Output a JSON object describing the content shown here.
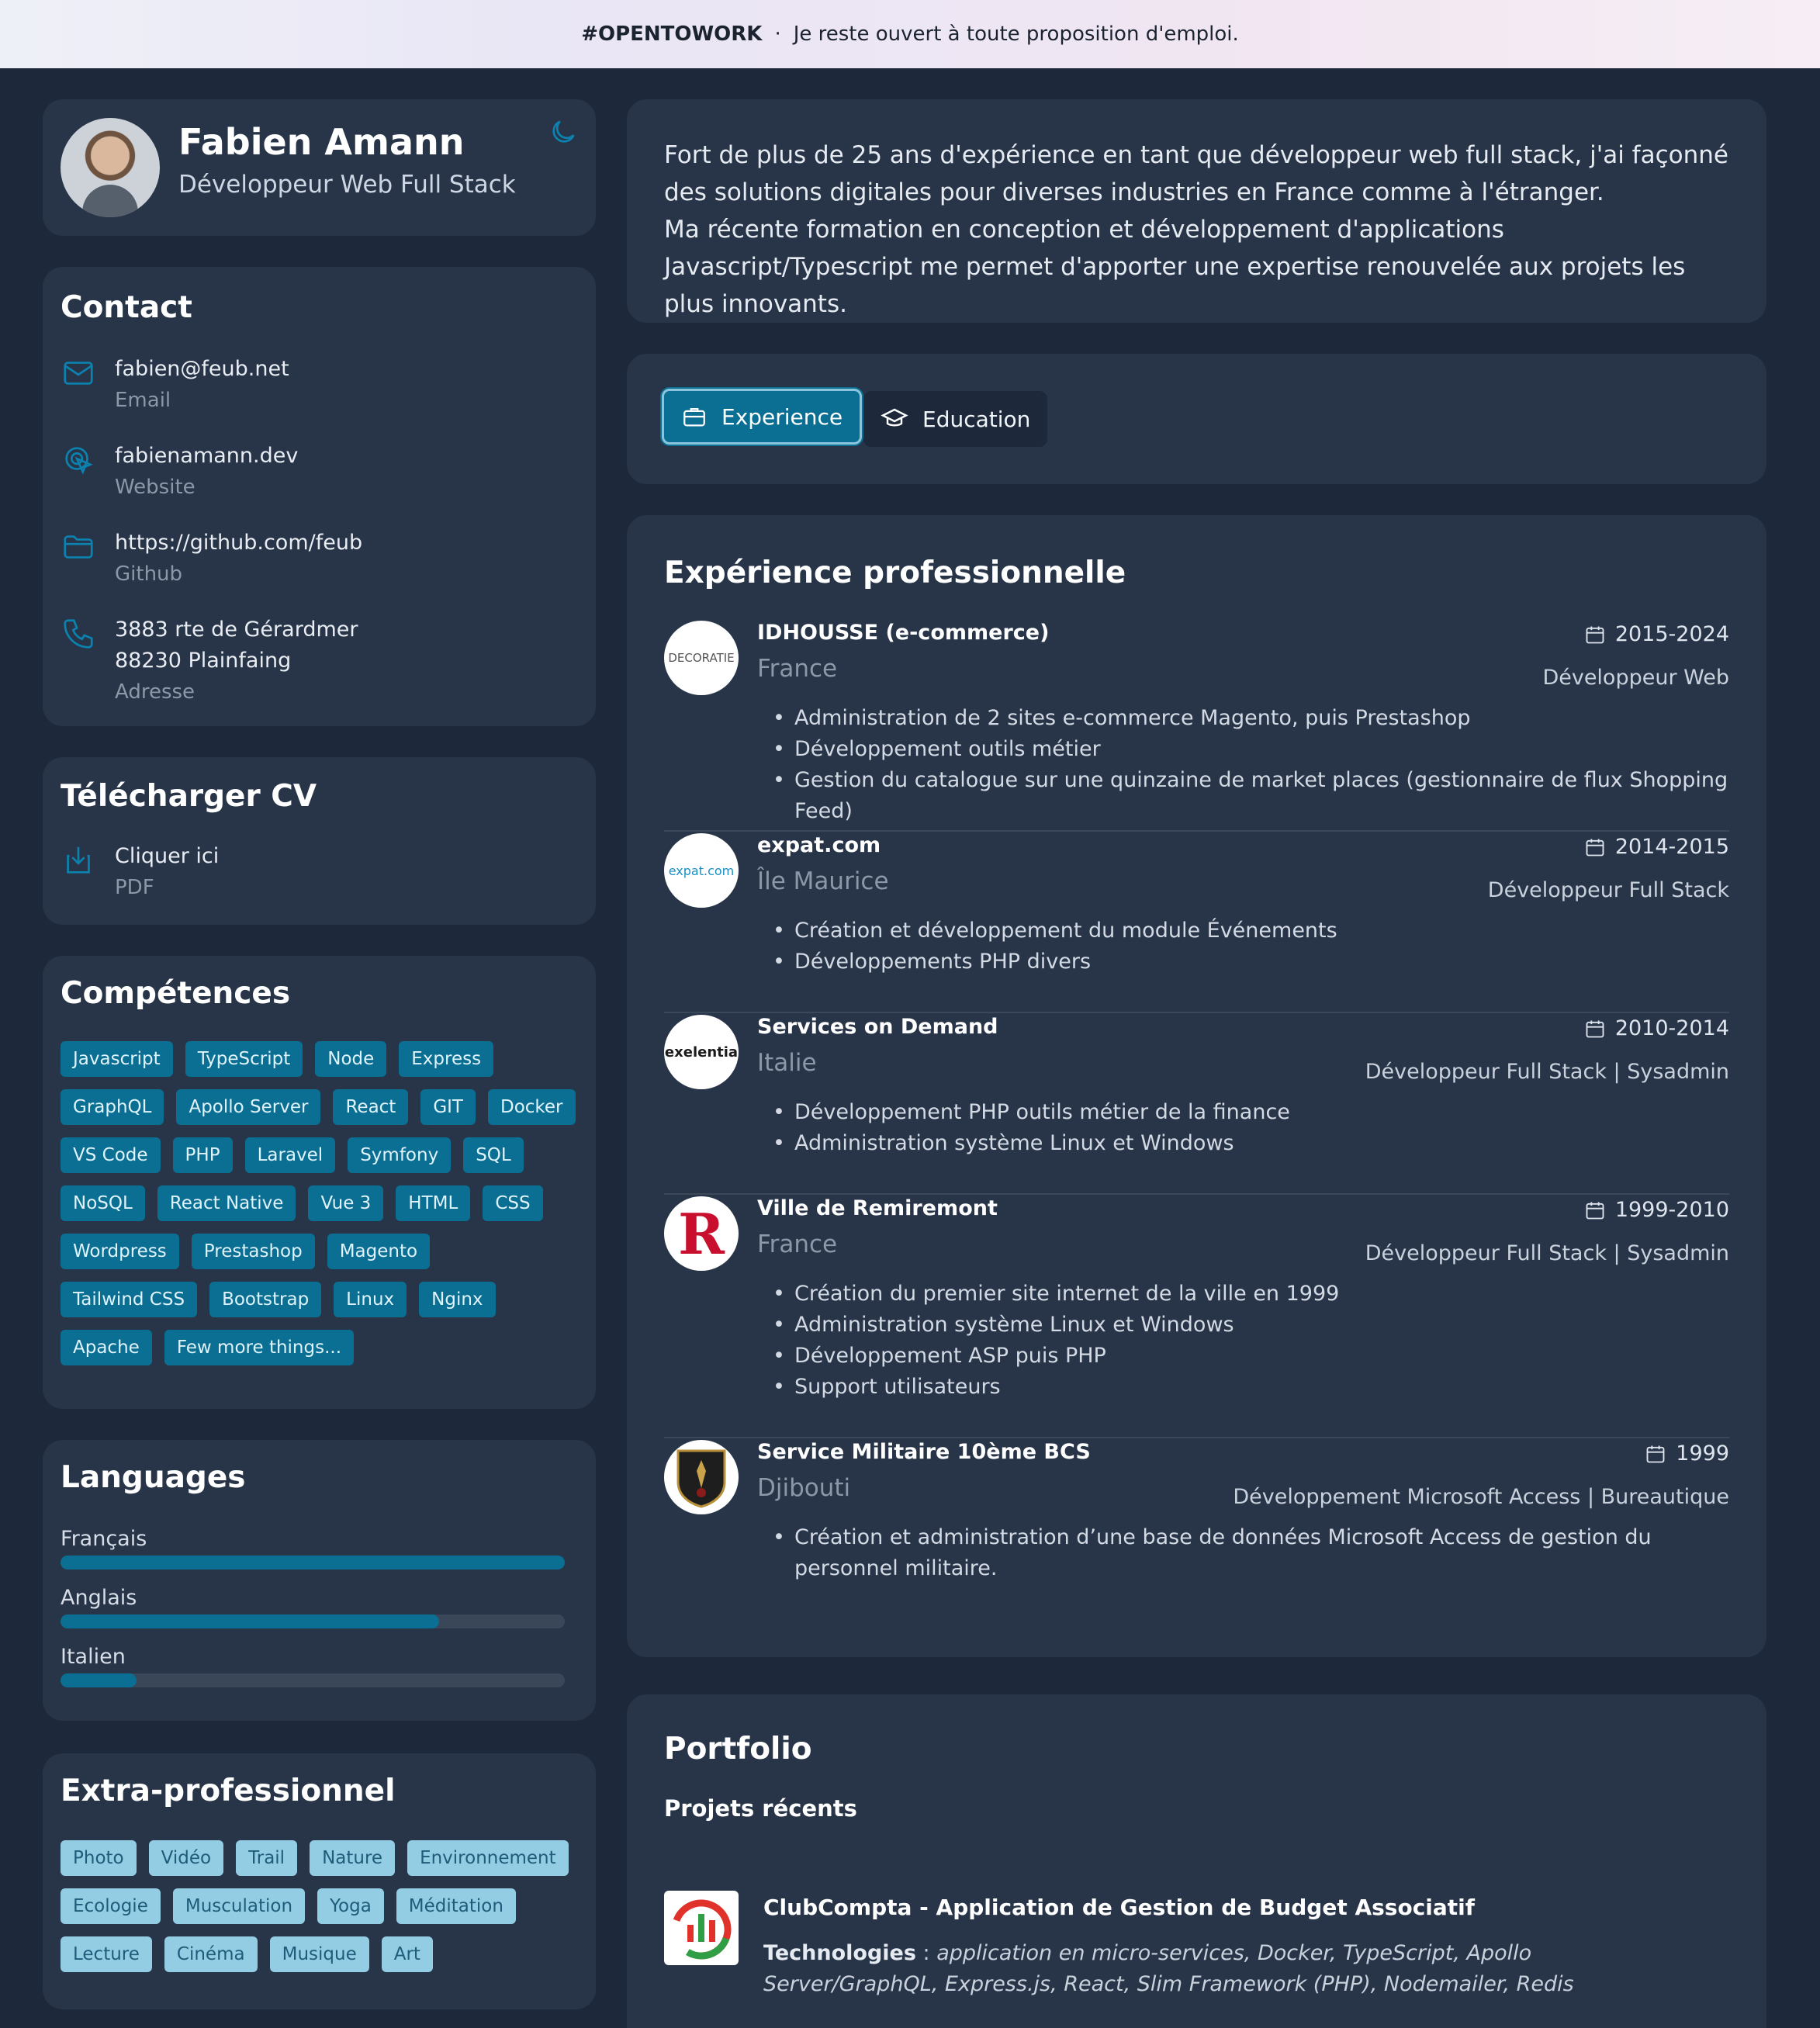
{
  "banner": {
    "tag": "#OPENTOWORK",
    "sep": "·",
    "text": "Je reste ouvert à toute proposition d'emploi."
  },
  "profile": {
    "name": "Fabien Amann",
    "title": "Développeur Web Full Stack",
    "theme_icon": "moon-icon"
  },
  "contact": {
    "title": "Contact",
    "items": [
      {
        "icon": "mail-icon",
        "value": "fabien@feub.net",
        "label": "Email"
      },
      {
        "icon": "pointer-icon",
        "value": "fabienamann.dev",
        "label": "Website"
      },
      {
        "icon": "folder-icon",
        "value": "https://github.com/feub",
        "label": "Github"
      },
      {
        "icon": "phone-icon",
        "value": "3883 rte de Gérardmer",
        "value2": "88230 Plainfaing",
        "label": "Adresse"
      }
    ]
  },
  "cv": {
    "title": "Télécharger CV",
    "value": "Cliquer ici",
    "label": "PDF",
    "icon": "download-icon"
  },
  "skills": {
    "title": "Compétences",
    "tags": [
      "Javascript",
      "TypeScript",
      "Node",
      "Express",
      "GraphQL",
      "Apollo Server",
      "React",
      "GIT",
      "Docker",
      "VS Code",
      "PHP",
      "Laravel",
      "Symfony",
      "SQL",
      "NoSQL",
      "React Native",
      "Vue 3",
      "HTML",
      "CSS",
      "Wordpress",
      "Prestashop",
      "Magento",
      "Tailwind CSS",
      "Bootstrap",
      "Linux",
      "Nginx",
      "Apache",
      "Few more things..."
    ]
  },
  "languages": {
    "title": "Languages",
    "items": [
      {
        "name": "Français",
        "level": 1.0
      },
      {
        "name": "Anglais",
        "level": 0.75
      },
      {
        "name": "Italien",
        "level": 0.15
      }
    ]
  },
  "extra": {
    "title": "Extra-professionnel",
    "tags": [
      "Photo",
      "Vidéo",
      "Trail",
      "Nature",
      "Environnement",
      "Ecologie",
      "Musculation",
      "Yoga",
      "Méditation",
      "Lecture",
      "Cinéma",
      "Musique",
      "Art"
    ]
  },
  "about": {
    "lines": [
      "Fort de plus de 25 ans d'expérience en tant que développeur web full stack, j'ai façonné des solutions digitales pour diverses industries en France comme à l'étranger.",
      "Ma récente formation en conception et développement d'applications Javascript/Typescript me permet d'apporter une expertise renouvelée aux projets les plus innovants."
    ]
  },
  "tabs": {
    "experience": "Experience",
    "education": "Education"
  },
  "experience": {
    "title": "Expérience professionnelle",
    "items": [
      {
        "company": "IDHOUSSE (e-commerce)",
        "logo_text": "DECORATIE",
        "place": "France",
        "date": "2015-2024",
        "role": "Développeur Web",
        "bullets": [
          "Administration de 2 sites e-commerce Magento, puis Prestashop",
          "Développement outils métier",
          "Gestion du catalogue sur une quinzaine de market places (gestionnaire de flux Shopping Feed)"
        ]
      },
      {
        "company": "expat.com",
        "logo_text": "expat.com",
        "place": "Île Maurice",
        "date": "2014-2015",
        "role": "Développeur Full Stack",
        "bullets": [
          "Création et développement du module Événements",
          "Développements PHP divers"
        ]
      },
      {
        "company": "Services on Demand",
        "logo_text": "exelentia",
        "place": "Italie",
        "date": "2010-2014",
        "role": "Développeur Full Stack | Sysadmin",
        "bullets": [
          "Développement PHP outils métier de la finance",
          "Administration système Linux et Windows"
        ]
      },
      {
        "company": "Ville de Remiremont",
        "logo_text": "R",
        "place": "France",
        "date": "1999-2010",
        "role": "Développeur Full Stack | Sysadmin",
        "bullets": [
          "Création du premier site internet de la ville en 1999",
          "Administration système Linux et Windows",
          "Développement ASP puis PHP",
          "Support utilisateurs"
        ]
      },
      {
        "company": "Service Militaire 10ème BCS",
        "logo_text": "",
        "place": "Djibouti",
        "date": "1999",
        "role": "Développement Microsoft Access | Bureautique",
        "bullets": [
          "Création et administration d’une base de données Microsoft Access de gestion du personnel militaire."
        ]
      }
    ]
  },
  "portfolio": {
    "title": "Portfolio",
    "subtitle": "Projets récents",
    "project": {
      "name": "ClubCompta - Application de Gestion de Budget Associatif",
      "tech_label": "Technologies",
      "tech_sep": " : ",
      "tech": "application en micro-services, Docker, TypeScript, Apollo Server/GraphQL, Express.js, React, Slim Framework (PHP), Nodemailer, Redis"
    }
  }
}
